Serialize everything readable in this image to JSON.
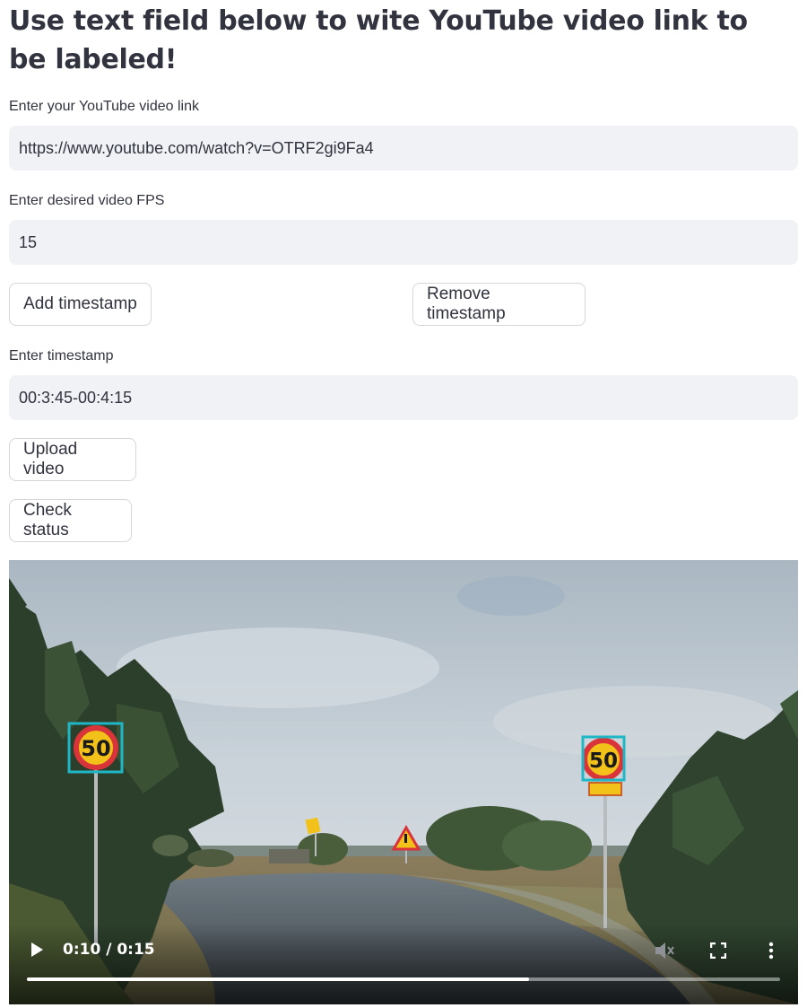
{
  "header": {
    "title": "Use text field below to wite YouTube video link to be labeled!"
  },
  "form": {
    "link_label": "Enter your YouTube video link",
    "link_value": "https://www.youtube.com/watch?v=OTRF2gi9Fa4",
    "fps_label": "Enter desired video FPS",
    "fps_value": "15",
    "add_timestamp": "Add timestamp",
    "remove_timestamp": "Remove timestamp",
    "timestamp_label": "Enter timestamp",
    "timestamp_value": "00:3:45-00:4:15",
    "upload_video": "Upload video",
    "check_status": "Check status"
  },
  "video": {
    "time_display": "0:10 / 0:15",
    "progress_fraction": 0.667,
    "sign_text_left": "50",
    "sign_text_right": "50",
    "detection_box_color": "#1fb6c6",
    "icons": [
      "play-icon",
      "volume-muted-icon",
      "fullscreen-icon",
      "more-options-icon"
    ]
  }
}
